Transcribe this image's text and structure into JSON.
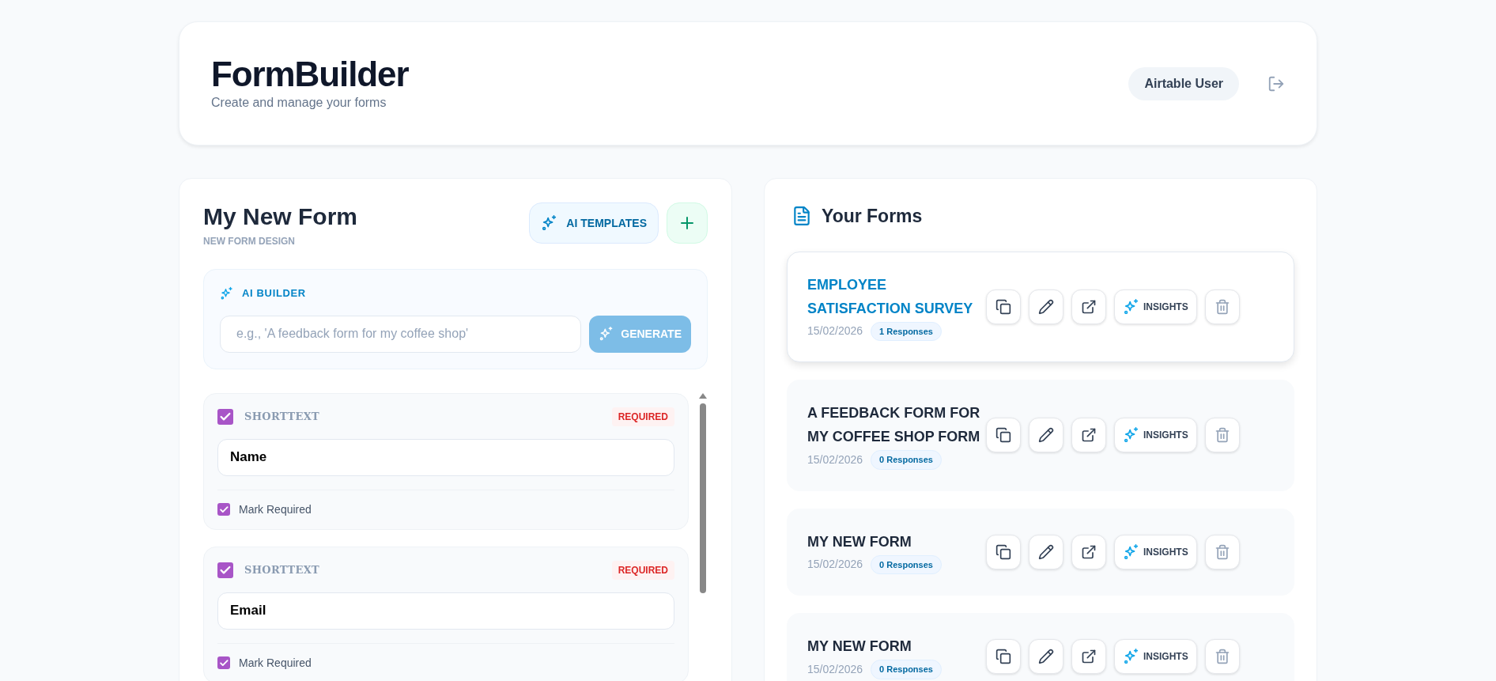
{
  "header": {
    "title": "FormBuilder",
    "subtitle": "Create and manage your forms",
    "user": "Airtable User"
  },
  "editor": {
    "title": "My New Form",
    "subtitle": "NEW FORM DESIGN",
    "templates_button": "AI TEMPLATES",
    "ai_builder": {
      "label": "AI BUILDER",
      "placeholder": "e.g., 'A feedback form for my coffee shop'",
      "button": "GENERATE",
      "button_disabled": true
    },
    "fields": [
      {
        "kind": "shorttext",
        "type_label": "SHORTTEXT",
        "checked": true,
        "badge": "REQUIRED",
        "value": "Name",
        "required_label": "Mark Required",
        "required": true
      },
      {
        "kind": "shorttext",
        "type_label": "SHORTTEXT",
        "checked": true,
        "badge": "REQUIRED",
        "value": "Email",
        "required_label": "Mark Required",
        "required": true
      }
    ]
  },
  "forms_panel": {
    "title": "Your Forms",
    "forms": [
      {
        "title": "EMPLOYEE SATISFACTION SURVEY",
        "date": "15/02/2026",
        "responses": "1 Responses",
        "insights": "INSIGHTS",
        "selected": true
      },
      {
        "title": "A FEEDBACK FORM FOR MY COFFEE SHOP FORM",
        "date": "15/02/2026",
        "responses": "0 Responses",
        "insights": "INSIGHTS",
        "selected": false
      },
      {
        "title": "MY NEW FORM",
        "date": "15/02/2026",
        "responses": "0 Responses",
        "insights": "INSIGHTS",
        "selected": false
      },
      {
        "title": "MY NEW FORM",
        "date": "15/02/2026",
        "responses": "0 Responses",
        "insights": "INSIGHTS",
        "selected": false
      }
    ]
  }
}
